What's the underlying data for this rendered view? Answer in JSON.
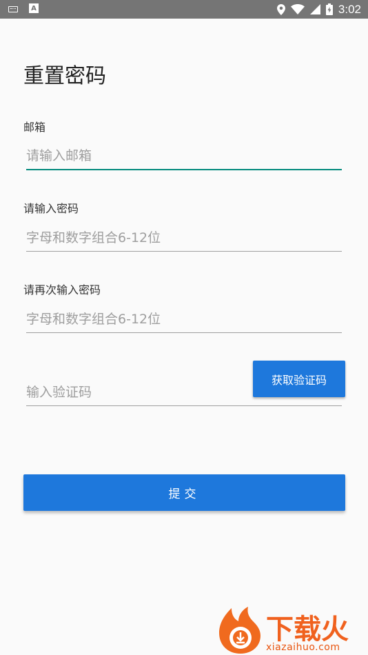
{
  "status_bar": {
    "time": "3:02",
    "icons": [
      "keyboard-icon",
      "a-icon",
      "location-icon",
      "wifi-icon",
      "signal-icon",
      "battery-icon"
    ]
  },
  "page": {
    "title": "重置密码"
  },
  "form": {
    "email": {
      "label": "邮箱",
      "placeholder": "请输入邮箱"
    },
    "password": {
      "label": "请输入密码",
      "placeholder": "字母和数字组合6-12位"
    },
    "confirm_password": {
      "label": "请再次输入密码",
      "placeholder": "字母和数字组合6-12位"
    },
    "code": {
      "placeholder": "输入验证码",
      "button_label": "获取验证码"
    },
    "submit_label": "提交"
  },
  "watermark": {
    "brand": "下载火",
    "url": "xiazaihuo.com"
  },
  "colors": {
    "accent": "#1e78dc",
    "focus": "#00897b",
    "statusbar": "#757575",
    "watermark": "#f0611e"
  }
}
